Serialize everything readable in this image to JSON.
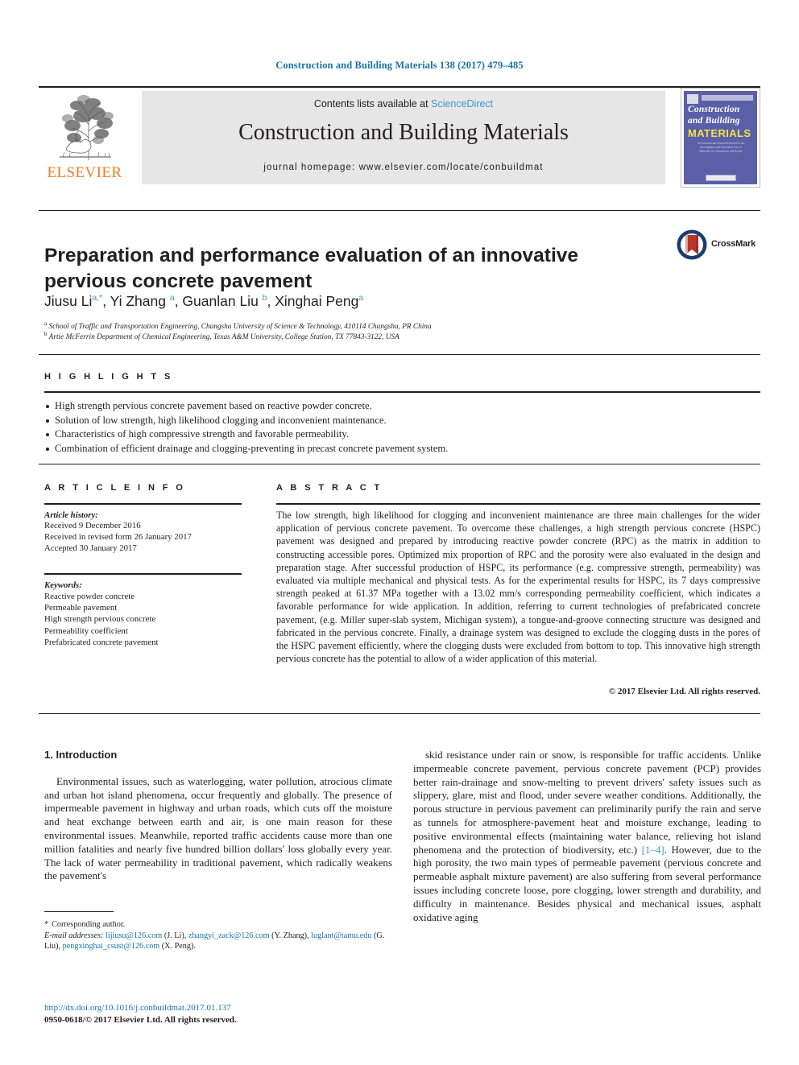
{
  "running_head": "Construction and Building Materials 138 (2017) 479–485",
  "masthead": {
    "publisher_name": "ELSEVIER",
    "contents_prefix": "Contents lists available at ",
    "contents_link": "ScienceDirect",
    "journal_title": "Construction and Building Materials",
    "homepage": "journal homepage: www.elsevier.com/locate/conbuildmat",
    "cover": {
      "line1": "Construction",
      "line2": "and Building",
      "line3": "MATERIALS",
      "blurb": "An International Journal dedicated to the Investigation and Innovative Use of Materials in Construction and Repair"
    }
  },
  "crossmark": {
    "label": "CrossMark",
    "ring_color": "#1b3c6e",
    "ribbon_color": "#b5362a"
  },
  "article": {
    "title": "Preparation and performance evaluation of an innovative pervious concrete pavement",
    "authors_html": "Jiusu Li<sup>a,*</sup>, Yi Zhang <sup>a</sup>, Guanlan Liu <sup>b</sup>, Xinghai Peng<sup>a</sup>",
    "affiliations": [
      "School of Traffic and Transportation Engineering, Changsha University of Science & Technology, 410114 Changsha, PR China",
      "Artie McFerrin Department of Chemical Engineering, Texas A&M University, College Station, TX 77843-3122, USA"
    ]
  },
  "highlights": {
    "label": "H I G H L I G H T S",
    "items": [
      "High strength pervious concrete pavement based on reactive powder concrete.",
      "Solution of low strength, high likelihood clogging and inconvenient maintenance.",
      "Characteristics of high compressive strength and favorable permeability.",
      "Combination of efficient drainage and clogging-preventing in precast concrete pavement system."
    ]
  },
  "article_info": {
    "label": "A R T I C L E   I N F O",
    "history_heading": "Article history:",
    "history": [
      "Received 9 December 2016",
      "Received in revised form 26 January 2017",
      "Accepted 30 January 2017"
    ],
    "keywords_heading": "Keywords:",
    "keywords": [
      "Reactive powder concrete",
      "Permeable pavement",
      "High strength pervious concrete",
      "Permeability coefficient",
      "Prefabricated concrete pavement"
    ]
  },
  "abstract": {
    "label": "A B S T R A C T",
    "text": "The low strength, high likelihood for clogging and inconvenient maintenance are three main challenges for the wider application of pervious concrete pavement. To overcome these challenges, a high strength pervious concrete (HSPC) pavement was designed and prepared by introducing reactive powder concrete (RPC) as the matrix in addition to constructing accessible pores. Optimized mix proportion of RPC and the porosity were also evaluated in the design and preparation stage. After successful production of HSPC, its performance (e.g. compressive strength, permeability) was evaluated via multiple mechanical and physical tests. As for the experimental results for HSPC, its 7 days compressive strength peaked at 61.37 MPa together with a 13.02 mm/s corresponding permeability coefficient, which indicates a favorable performance for wide application. In addition, referring to current technologies of prefabricated concrete pavement, (e.g. Miller super-slab system, Michigan system), a tongue-and-groove connecting structure was designed and fabricated in the pervious concrete. Finally, a drainage system was designed to exclude the clogging dusts in the pores of the HSPC pavement efficiently, where the clogging dusts were excluded from bottom to top. This innovative high strength pervious concrete has the potential to allow of a wider application of this material.",
    "copyright": "© 2017 Elsevier Ltd. All rights reserved."
  },
  "body": {
    "section_heading": "1. Introduction",
    "left_paragraph": "Environmental issues, such as waterlogging, water pollution, atrocious climate and urban hot island phenomena, occur frequently and globally. The presence of impermeable pavement in highway and urban roads, which cuts off the moisture and heat exchange between earth and air, is one main reason for these environmental issues. Meanwhile, reported traffic accidents cause more than one million fatalities and nearly five hundred billion dollars' loss globally every year. The lack of water permeability in traditional pavement, which radically weakens the pavement's",
    "right_paragraph_part1": "skid resistance under rain or snow, is responsible for traffic accidents. Unlike impermeable concrete pavement, pervious concrete pavement (PCP) provides better rain-drainage and snow-melting to prevent drivers' safety issues such as slippery, glare, mist and flood, under severe weather conditions. Additionally, the porous structure in pervious pavement can preliminarily purify the rain and serve as tunnels for atmosphere-pavement heat and moisture exchange, leading to positive environmental effects (maintaining water balance, relieving hot island phenomena and the protection of biodiversity, etc.) ",
    "right_citation": "[1–4]",
    "right_paragraph_part2": ". However, due to the high porosity, the two main types of permeable pavement (pervious concrete and permeable asphalt mixture pavement) are also suffering from several performance issues including concrete loose, pore clogging, lower strength and durability, and difficulty in maintenance. Besides physical and mechanical issues, asphalt oxidative aging"
  },
  "footnote": {
    "corresponding_marker": "*",
    "corresponding_text": "Corresponding author.",
    "email_label": "E-mail addresses:",
    "emails": [
      {
        "address": "lijiusu@126.com",
        "person": "(J. Li),"
      },
      {
        "address": "zhangyi_zack@126.com",
        "person": "(Y. Zhang),"
      },
      {
        "address": "luglant@tamu.edu",
        "person": "(G. Liu),"
      },
      {
        "address": "pengxinghai_csust@126.com",
        "person": "(X. Peng)."
      }
    ]
  },
  "doi_block": {
    "doi": "http://dx.doi.org/10.1016/j.conbuildmat.2017.01.137",
    "issn_line": "0950-0618/© 2017 Elsevier Ltd. All rights reserved."
  }
}
